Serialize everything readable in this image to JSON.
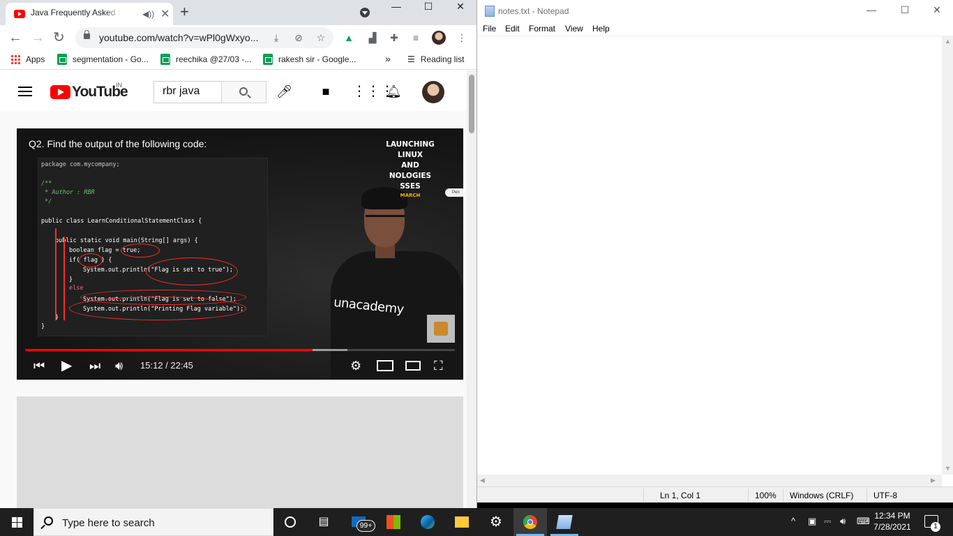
{
  "chrome": {
    "tab_title": "Java Frequently Asked Interv",
    "url": "youtube.com/watch?v=wPl0gWxyo...",
    "bookmarks": [
      {
        "label": "Apps",
        "icon": "apps-grid-icon"
      },
      {
        "label": "segmentation - Go...",
        "icon": "sheets-icon"
      },
      {
        "label": "reechika @27/03 -...",
        "icon": "sheets-icon"
      },
      {
        "label": "rakesh sir - Google...",
        "icon": "sheets-icon"
      }
    ],
    "bookmarks_overflow": "»",
    "reading_list": "Reading list"
  },
  "youtube": {
    "logo_text": "YouTube",
    "country_code": "IN",
    "search_value": "rbr java",
    "video": {
      "question": "Q2.  Find the output of the following code:",
      "code_lines": [
        "package com.mycompany;",
        "/**",
        " * Author : RBR",
        " */",
        "public class LearnConditionalStatementClass {",
        "public static void main(String[] args) {",
        "boolean flag = true;",
        "if( flag ) {",
        "System.out.println(\"Flag is set to true\");",
        "}",
        "else",
        "System.out.println(\"Flag is set to false\");",
        "System.out.println(\"Printing Flag variable\");",
        "}",
        "}"
      ],
      "promo_lines": [
        "LAUNCHING",
        "LINUX",
        "AND",
        "NOLOGIES",
        "SSES"
      ],
      "promo_date": "MARCH",
      "promo_badge": "Pen",
      "shirt_brand": "unacademy",
      "time_current": "15:12",
      "time_total": "22:45",
      "time_display": "15:12 / 22:45",
      "progress_played_fraction": 0.669,
      "progress_buffered_fraction": 0.75
    }
  },
  "notepad": {
    "title": "notes.txt - Notepad",
    "menu": [
      "File",
      "Edit",
      "Format",
      "View",
      "Help"
    ],
    "status": {
      "position": "Ln 1, Col 1",
      "zoom": "100%",
      "line_endings": "Windows (CRLF)",
      "encoding": "UTF-8"
    }
  },
  "taskbar": {
    "search_placeholder": "Type here to search",
    "mail_badge": "99+",
    "time": "12:34 PM",
    "date": "7/28/2021",
    "notification_count": "1",
    "apps": [
      "cortana-icon",
      "task-view-icon",
      "mail-icon",
      "store-icon",
      "edge-icon",
      "file-explorer-icon",
      "settings-icon",
      "chrome-icon",
      "notepad-icon"
    ]
  }
}
